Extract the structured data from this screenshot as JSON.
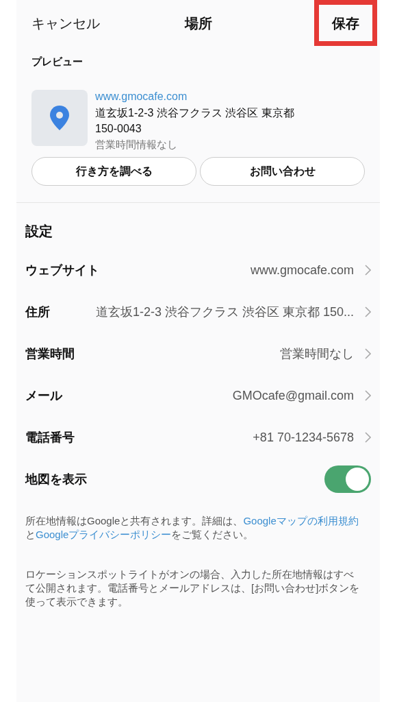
{
  "header": {
    "cancel": "キャンセル",
    "title": "場所",
    "save": {
      "label": "保存",
      "highlighted": true
    }
  },
  "preview": {
    "label": "プレビュー",
    "website": "www.gmocafe.com",
    "address": "道玄坂1-2-3 渋谷フクラス 渋谷区 東京都 150-0043",
    "hours": "営業時間情報なし",
    "buttons": [
      "行き方を調べる",
      "お問い合わせ"
    ]
  },
  "settings": {
    "title": "設定",
    "rows": [
      {
        "kind": "link",
        "label": "ウェブサイト",
        "value": "www.gmocafe.com"
      },
      {
        "kind": "link",
        "label": "住所",
        "value": "道玄坂1-2-3 渋谷フクラス 渋谷区 東京都 150..."
      },
      {
        "kind": "link",
        "label": "営業時間",
        "value": "営業時間なし"
      },
      {
        "kind": "link",
        "label": "メール",
        "value": "GMOcafe@gmail.com"
      },
      {
        "kind": "link",
        "label": "電話番号",
        "value": "+81 70-1234-5678"
      },
      {
        "kind": "toggle",
        "label": "地図を表示",
        "on": true
      }
    ]
  },
  "notes": [
    [
      {
        "kind": "text",
        "text": "所在地情報はGoogleと共有されます。詳細は、"
      },
      {
        "kind": "link",
        "text": "Googleマップの利用規約"
      },
      {
        "kind": "text",
        "text": "と"
      },
      {
        "kind": "link",
        "text": "Googleプライバシーポリシー"
      },
      {
        "kind": "text",
        "text": "をご覧ください。"
      }
    ],
    [
      {
        "kind": "text",
        "text": "ロケーションスポットライトがオンの場合、入力した所在地情報はすべて公開されます。電話番号とメールアドレスは、[お問い合わせ]ボタンを使って表示できます。"
      }
    ]
  ]
}
